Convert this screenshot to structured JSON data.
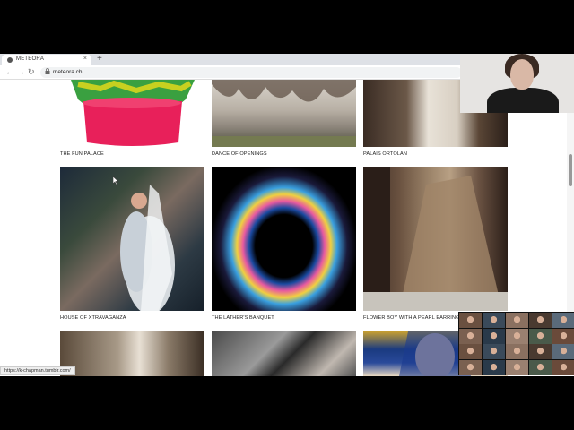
{
  "browser": {
    "tab_title": "METEORA",
    "tab_close": "×",
    "new_tab": "+",
    "back": "←",
    "forward": "→",
    "reload": "↻",
    "lock": "🔒",
    "url": "meteora.ch"
  },
  "gallery": {
    "items": [
      {
        "label": "THE FUN PALACE"
      },
      {
        "label": "DANCE OF OPENINGS"
      },
      {
        "label": "PALAIS ORTOLAN"
      },
      {
        "label": "HOUSE OF XTRAVAGANZA"
      },
      {
        "label": "THE LATHER'S BANQUET"
      },
      {
        "label": "FLOWER BOY WITH A PEARL EARRING"
      },
      {
        "label": ""
      },
      {
        "label": ""
      },
      {
        "label": ""
      }
    ]
  },
  "status_bar": {
    "link": "https://k-chapman.tumblr.com/"
  },
  "icons": {
    "cursor": "arrow-cursor-icon"
  },
  "colors": {
    "page_bg": "#ffffff",
    "outer_bg": "#000000"
  }
}
